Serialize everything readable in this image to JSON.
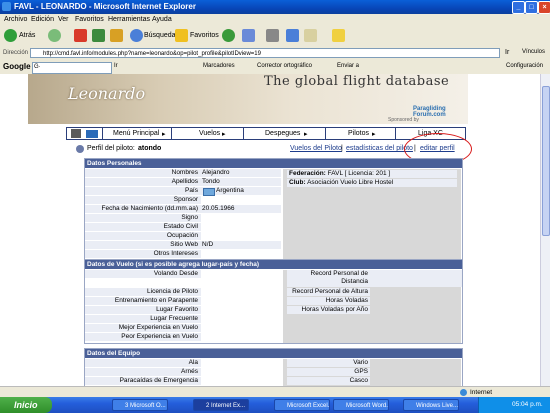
{
  "window": {
    "title": "FAVL - LEONARDO - Microsoft Internet Explorer",
    "minimize": "_",
    "maximize": "□",
    "close": "×"
  },
  "menu": [
    "Archivo",
    "Edición",
    "Ver",
    "Favoritos",
    "Herramientas",
    "Ayuda"
  ],
  "toolbar": {
    "back": "Atrás",
    "search": "Búsqueda",
    "favorites": "Favoritos"
  },
  "address": {
    "label": "Dirección",
    "url": "http://cmd.favl.info/modules.php?name=leonardo&op=pilot_profile&pilotIDview=19",
    "go": "Ir",
    "links": "Vínculos"
  },
  "googlebar": {
    "logo": "Google",
    "search_field": "G·",
    "go": "Ir",
    "bookmarks": "Marcadores",
    "spellcheck": "Corrector ortográfico",
    "send": "Enviar a",
    "settings": "Configuración"
  },
  "site": {
    "logo": "Leonardo",
    "tagline": "The global flight database",
    "partner_logo": "Paragliding Forum.com",
    "sponsored": "Sponsored by"
  },
  "nav": {
    "items": [
      "Menú Principal",
      "Vuelos",
      "Despegues",
      "Pilotos",
      "Liga XC"
    ]
  },
  "profile": {
    "label": "Perfil del piloto:",
    "name": "atondo",
    "links": [
      "Vuelos del Piloto",
      "estadísticas del piloto",
      "editar perfil"
    ],
    "separator": "|"
  },
  "personal": {
    "header": "Datos Personales",
    "rows": [
      {
        "label": "Nombres",
        "value": "Alejandro"
      },
      {
        "label": "Apellidos",
        "value": "Tondo"
      },
      {
        "label": "País",
        "value": "Argentina"
      },
      {
        "label": "Sponsor",
        "value": ""
      },
      {
        "label": "Fecha de Nacimiento (dd.mm.aa)",
        "value": "20.05.1966"
      },
      {
        "label": "Signo",
        "value": ""
      },
      {
        "label": "Estado Civil",
        "value": ""
      },
      {
        "label": "Ocupación",
        "value": ""
      },
      {
        "label": "Sitio Web",
        "value": "N/D"
      },
      {
        "label": "Otros Intereses",
        "value": ""
      }
    ],
    "federation_label": "Federación:",
    "federation_value": "FAVL [ Licencia: 201 ]",
    "club_label": "Club:",
    "club_value": "Asociación Vuelo Libre Hostel"
  },
  "flight": {
    "header": "Datos de Vuelo (si es posible agrega lugar-país y fecha)",
    "left_rows": [
      "Volando Desde",
      "",
      "Licencia de Piloto",
      "Entrenamiento en Parapente",
      "Lugar Favorito",
      "Lugar Frecuente",
      "Mejor Experiencia en Vuelo",
      "Peor Experiencia en Vuelo"
    ],
    "right_rows": [
      "Record Personal de Distancia",
      "Record Personal de Altura",
      "Horas Voladas",
      "Horas Voladas por Año"
    ]
  },
  "equipment": {
    "header": "Datos del Equipo",
    "left_rows": [
      "Ala",
      "Arnés",
      "Paracaídas de Emergencia"
    ],
    "right_rows": [
      "Vario",
      "GPS",
      "Casco"
    ]
  },
  "status": {
    "zone": "Internet"
  },
  "taskbar": {
    "start": "Inicio",
    "tasks": [
      "3 Microsoft O...",
      "2 Internet Ex...",
      "Microsoft Excel...",
      "Microsoft Word...",
      "Windows Live..."
    ],
    "clock": "05:04 p.m."
  }
}
